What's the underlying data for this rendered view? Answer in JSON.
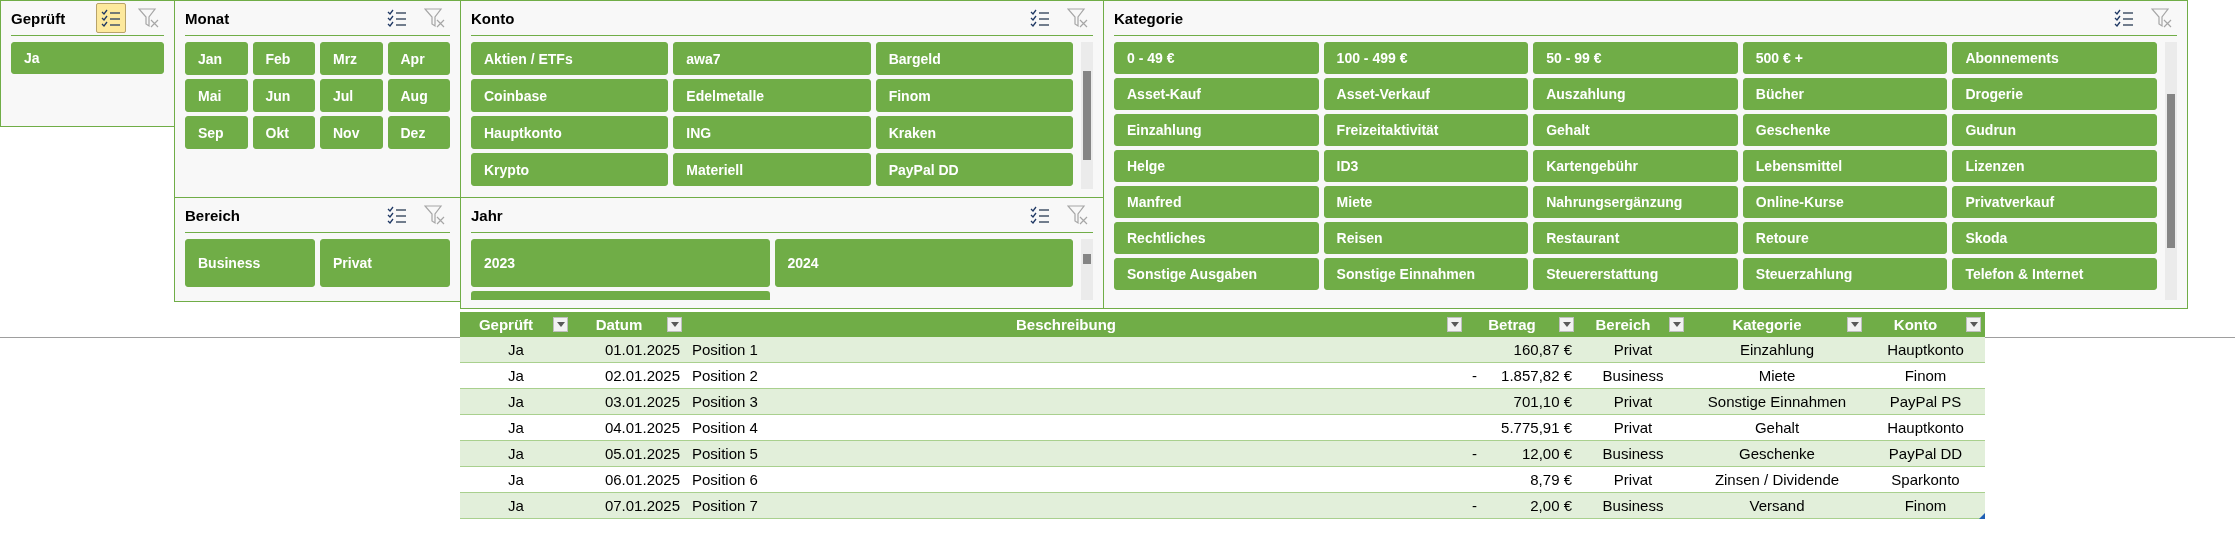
{
  "slicers": [
    {
      "title": "Geprüft",
      "multi_select": true,
      "items": [
        {
          "label": "Ja",
          "selected": true
        }
      ]
    },
    {
      "title": "Monat",
      "multi_select": false,
      "items": [
        {
          "label": "Jan",
          "selected": true
        },
        {
          "label": "Feb",
          "selected": true
        },
        {
          "label": "Mrz",
          "selected": true
        },
        {
          "label": "Apr",
          "selected": true
        },
        {
          "label": "Mai",
          "selected": true
        },
        {
          "label": "Jun",
          "selected": true
        },
        {
          "label": "Jul",
          "selected": true
        },
        {
          "label": "Aug",
          "selected": true
        },
        {
          "label": "Sep",
          "selected": true
        },
        {
          "label": "Okt",
          "selected": true
        },
        {
          "label": "Nov",
          "selected": true
        },
        {
          "label": "Dez",
          "selected": true
        }
      ]
    },
    {
      "title": "Bereich",
      "multi_select": false,
      "items": [
        {
          "label": "Business",
          "selected": true
        },
        {
          "label": "Privat",
          "selected": true
        }
      ]
    },
    {
      "title": "Konto",
      "multi_select": false,
      "items": [
        {
          "label": "Aktien / ETFs",
          "selected": true
        },
        {
          "label": "awa7",
          "selected": true
        },
        {
          "label": "Bargeld",
          "selected": true
        },
        {
          "label": "Coinbase",
          "selected": true
        },
        {
          "label": "Edelmetalle",
          "selected": true
        },
        {
          "label": "Finom",
          "selected": true
        },
        {
          "label": "Hauptkonto",
          "selected": true
        },
        {
          "label": "ING",
          "selected": true
        },
        {
          "label": "Kraken",
          "selected": true
        },
        {
          "label": "Krypto",
          "selected": true
        },
        {
          "label": "Materiell",
          "selected": true
        },
        {
          "label": "PayPal DD",
          "selected": true
        }
      ]
    },
    {
      "title": "Jahr",
      "multi_select": false,
      "more_below": true,
      "items": [
        {
          "label": "2023",
          "selected": true
        },
        {
          "label": "2024",
          "selected": true
        }
      ]
    },
    {
      "title": "Kategorie",
      "multi_select": false,
      "items": [
        {
          "label": "0 - 49 €",
          "selected": true
        },
        {
          "label": "100 - 499 €",
          "selected": true
        },
        {
          "label": "50 - 99 €",
          "selected": true
        },
        {
          "label": "500 € +",
          "selected": true
        },
        {
          "label": "Abonnements",
          "selected": true
        },
        {
          "label": "Asset-Kauf",
          "selected": true
        },
        {
          "label": "Asset-Verkauf",
          "selected": true
        },
        {
          "label": "Auszahlung",
          "selected": true
        },
        {
          "label": "Bücher",
          "selected": true
        },
        {
          "label": "Drogerie",
          "selected": true
        },
        {
          "label": "Einzahlung",
          "selected": true
        },
        {
          "label": "Freizeitaktivität",
          "selected": true
        },
        {
          "label": "Gehalt",
          "selected": true
        },
        {
          "label": "Geschenke",
          "selected": true
        },
        {
          "label": "Gudrun",
          "selected": true
        },
        {
          "label": "Helge",
          "selected": true
        },
        {
          "label": "ID3",
          "selected": true
        },
        {
          "label": "Kartengebühr",
          "selected": true
        },
        {
          "label": "Lebensmittel",
          "selected": true
        },
        {
          "label": "Lizenzen",
          "selected": true
        },
        {
          "label": "Manfred",
          "selected": true
        },
        {
          "label": "Miete",
          "selected": true
        },
        {
          "label": "Nahrungsergänzung",
          "selected": true
        },
        {
          "label": "Online-Kurse",
          "selected": true
        },
        {
          "label": "Privatverkauf",
          "selected": true
        },
        {
          "label": "Rechtliches",
          "selected": true
        },
        {
          "label": "Reisen",
          "selected": true
        },
        {
          "label": "Restaurant",
          "selected": true
        },
        {
          "label": "Retoure",
          "selected": true
        },
        {
          "label": "Skoda",
          "selected": true
        },
        {
          "label": "Sonstige Ausgaben",
          "selected": true
        },
        {
          "label": "Sonstige Einnahmen",
          "selected": true
        },
        {
          "label": "Steuererstattung",
          "selected": true
        },
        {
          "label": "Steuerzahlung",
          "selected": true
        },
        {
          "label": "Telefon & Internet",
          "selected": true
        }
      ]
    }
  ],
  "table": {
    "columns": [
      "Geprüft",
      "Datum",
      "Beschreibung",
      "Betrag",
      "Bereich",
      "Kategorie",
      "Konto"
    ],
    "rows": [
      {
        "geprueft": "Ja",
        "datum": "01.01.2025",
        "beschreibung": "Position 1",
        "betrag": "160,87 €",
        "bereich": "Privat",
        "kategorie": "Einzahlung",
        "konto": "Hauptkonto"
      },
      {
        "geprueft": "Ja",
        "datum": "02.01.2025",
        "beschreibung": "Position 2",
        "sign": "-",
        "betrag": "1.857,82 €",
        "bereich": "Business",
        "kategorie": "Miete",
        "konto": "Finom"
      },
      {
        "geprueft": "Ja",
        "datum": "03.01.2025",
        "beschreibung": "Position 3",
        "betrag": "701,10 €",
        "bereich": "Privat",
        "kategorie": "Sonstige Einnahmen",
        "konto": "PayPal PS"
      },
      {
        "geprueft": "Ja",
        "datum": "04.01.2025",
        "beschreibung": "Position 4",
        "betrag": "5.775,91 €",
        "bereich": "Privat",
        "kategorie": "Gehalt",
        "konto": "Hauptkonto"
      },
      {
        "geprueft": "Ja",
        "datum": "05.01.2025",
        "beschreibung": "Position 5",
        "sign": "-",
        "betrag": "12,00 €",
        "bereich": "Business",
        "kategorie": "Geschenke",
        "konto": "PayPal DD"
      },
      {
        "geprueft": "Ja",
        "datum": "06.01.2025",
        "beschreibung": "Position 6",
        "betrag": "8,79 €",
        "bereich": "Privat",
        "kategorie": "Zinsen / Dividende",
        "konto": "Sparkonto"
      },
      {
        "geprueft": "Ja",
        "datum": "07.01.2025",
        "beschreibung": "Position 7",
        "sign": "-",
        "betrag": "2,00 €",
        "bereich": "Business",
        "kategorie": "Versand",
        "konto": "Finom"
      }
    ]
  }
}
